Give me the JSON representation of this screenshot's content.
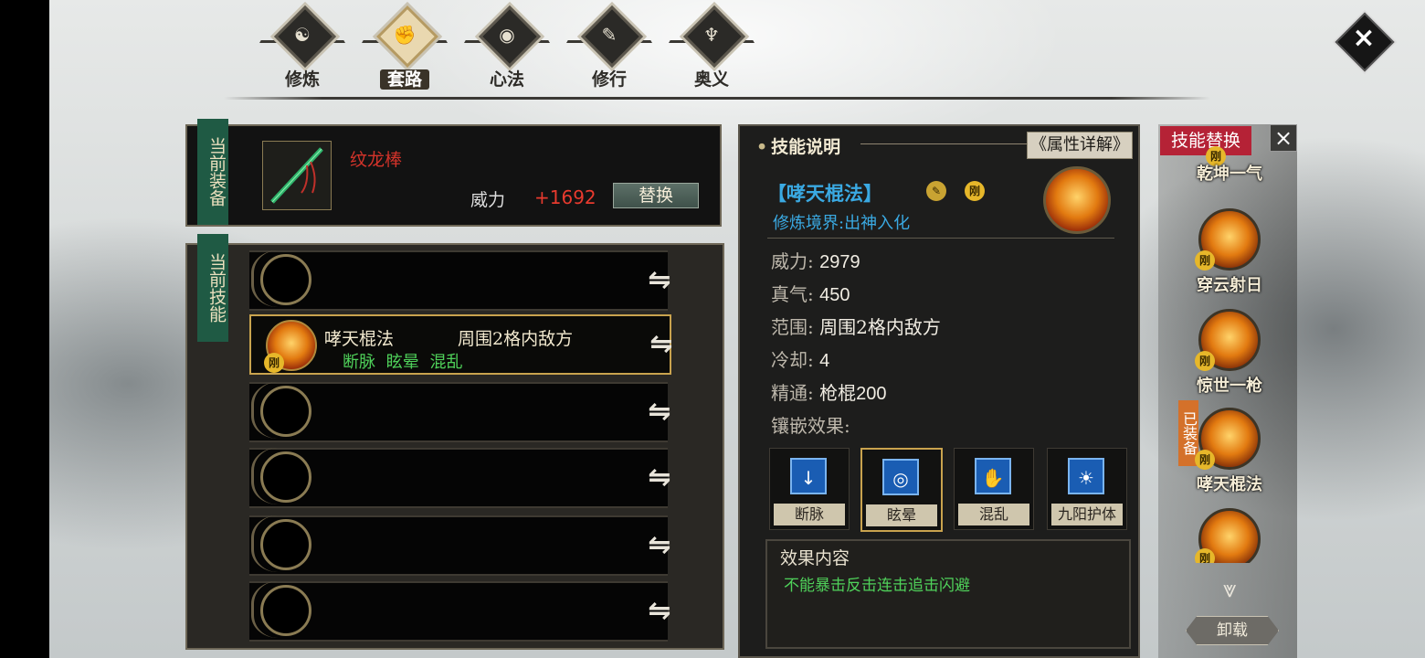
{
  "tabs": [
    {
      "label": "修炼",
      "icon": "cultivate-icon",
      "active": false
    },
    {
      "label": "套路",
      "icon": "fist-icon",
      "active": true
    },
    {
      "label": "心法",
      "icon": "mind-icon",
      "active": false
    },
    {
      "label": "修行",
      "icon": "practice-icon",
      "active": false
    },
    {
      "label": "奥义",
      "icon": "mystery-icon",
      "active": false
    }
  ],
  "close_label": "×",
  "equipment": {
    "side_label": "当前装备",
    "weapon_name": "纹龙棒",
    "power_label": "威力",
    "power_value": "+1692",
    "swap_label": "替换"
  },
  "skills": {
    "side_label": "当前技能",
    "selected": {
      "name": "哮天棍法",
      "range": "周围2格内敌方",
      "tags": "断脉 眩晕 混乱",
      "badge": "刚"
    }
  },
  "detail": {
    "header": "技能说明",
    "attr_button": "《属性详解》",
    "name": "【哮天棍法】",
    "badge": "刚",
    "realm": "修炼境界:出神入化",
    "stats": [
      {
        "k": "威力:",
        "v": "2979"
      },
      {
        "k": "真气:",
        "v": "450"
      },
      {
        "k": "范围:",
        "v": "周围2格内敌方"
      },
      {
        "k": "冷却:",
        "v": "4"
      },
      {
        "k": "精通:",
        "v": "枪棍200"
      }
    ],
    "inlay_label": "镶嵌效果:",
    "inlays": [
      {
        "name": "断脉",
        "glyph": "↓",
        "selected": false
      },
      {
        "name": "眩晕",
        "glyph": "◎",
        "selected": true
      },
      {
        "name": "混乱",
        "glyph": "✋",
        "selected": false
      },
      {
        "name": "九阳护体",
        "glyph": "☀",
        "selected": false
      }
    ],
    "effect_title": "效果内容",
    "effect_text": "不能暴击反击连击追击闪避"
  },
  "replace": {
    "title": "技能替换",
    "close": "×",
    "items": [
      {
        "name": "乾坤一气",
        "badge": "刚"
      },
      {
        "name": "穿云射日",
        "badge": "刚"
      },
      {
        "name": "惊世一枪",
        "badge": "刚"
      },
      {
        "name": "哮天棍法",
        "badge": "刚",
        "equipped": "已装备"
      },
      {
        "name": "",
        "badge": "刚"
      }
    ],
    "unload_label": "卸载"
  },
  "colors": {
    "accent_gold": "#c9a34e",
    "skill_blue": "#3aa9e2",
    "effect_green": "#4fd15a",
    "power_red": "#e83a2e",
    "replace_title_bg": "#b52236"
  }
}
